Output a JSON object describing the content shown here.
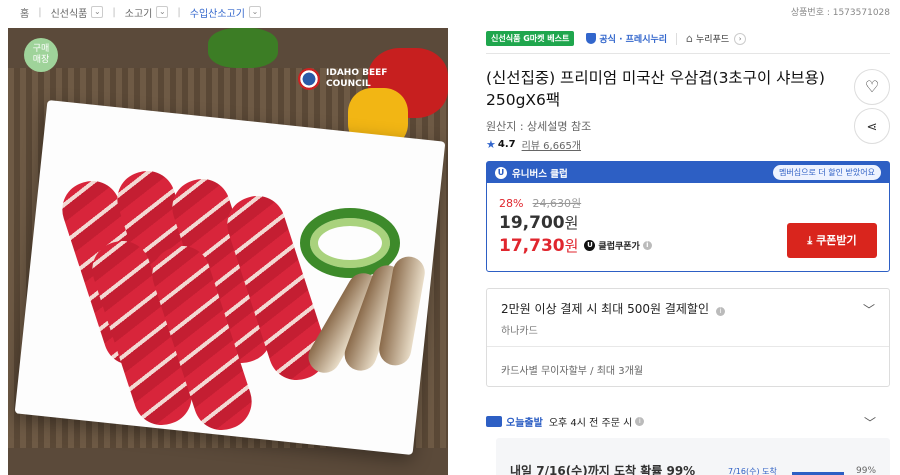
{
  "breadcrumb": {
    "home": "홈",
    "cat1": "신선식품",
    "cat2": "소고기",
    "cat3": "수입산소고기"
  },
  "product_no": "상품번호 : 1573571028",
  "image": {
    "store_badge": "구매\n매장",
    "logo_text": "IDAHO BEEF\nCOUNCIL"
  },
  "tags": {
    "gbest": "신선식품 G마켓 베스트",
    "official": "공식 · 프레시누리",
    "shop": "누리푸드"
  },
  "title": "(신선집중) 프리미엄 미국산 우삼겹(3초구이 샤브용) 250gX6팩",
  "origin": "원산지 : 상세설명 참조",
  "rating": {
    "score": "4.7",
    "review_label": "리뷰 6,665개"
  },
  "price": {
    "club_label": "유니버스 클럽",
    "member_msg": "멤버십으로 더 할인 받았어요",
    "discount": "28%",
    "original": "24,630원",
    "price": "19,700",
    "club_price": "17,730",
    "won": "원",
    "club_coupon": "클럽쿠폰가",
    "coupon_button": "쿠폰받기"
  },
  "card": {
    "title": "2만원 이상 결제 시 최대 500원 결제할인",
    "issuer": "하나카드",
    "installment": "카드사별 무이자할부 / 최대 3개월"
  },
  "delivery": {
    "today": "오늘출발",
    "cutoff": "오후 4시 전 주문 시",
    "panel_text": "내일 7/16(수)까지 도착 확률 99%",
    "date_small": "7/16(수) 도착",
    "pct": "99%",
    "pct_value": 0.99
  },
  "colors": {
    "accent": "#2d5fc4",
    "red": "#e0262e",
    "green": "#1fa64d"
  }
}
